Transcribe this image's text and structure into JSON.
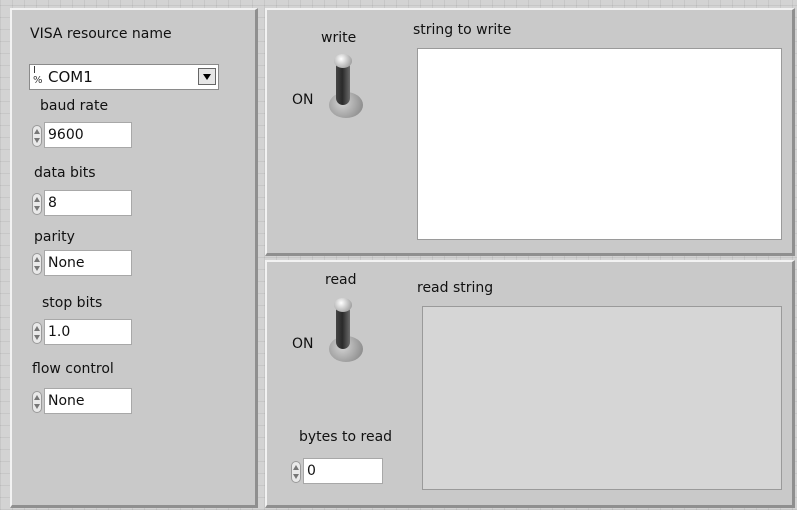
{
  "serial_panel": {
    "visa_label": "VISA resource name",
    "visa_value": "COM1",
    "visa_glyph": "I/%",
    "baud_label": "baud rate",
    "baud_value": "9600",
    "data_bits_label": "data bits",
    "data_bits_value": "8",
    "parity_label": "parity",
    "parity_value": "None",
    "stop_bits_label": "stop bits",
    "stop_bits_value": "1.0",
    "flow_label": "flow control",
    "flow_value": "None"
  },
  "write_panel": {
    "switch_label": "write",
    "switch_state": "ON",
    "string_label": "string to write",
    "string_value": ""
  },
  "read_panel": {
    "switch_label": "read",
    "switch_state": "ON",
    "string_label": "read string",
    "string_value": "",
    "bytes_label": "bytes to read",
    "bytes_value": "0"
  },
  "colors": {
    "background": "#d3d3d3",
    "panel": "#c9c9c9",
    "write_box": "#ffffff",
    "read_box": "#d6d6d6"
  },
  "icons": [
    "visa-io-icon",
    "dropdown-arrow-icon",
    "spinner-icon",
    "toggle-switch-icon"
  ]
}
